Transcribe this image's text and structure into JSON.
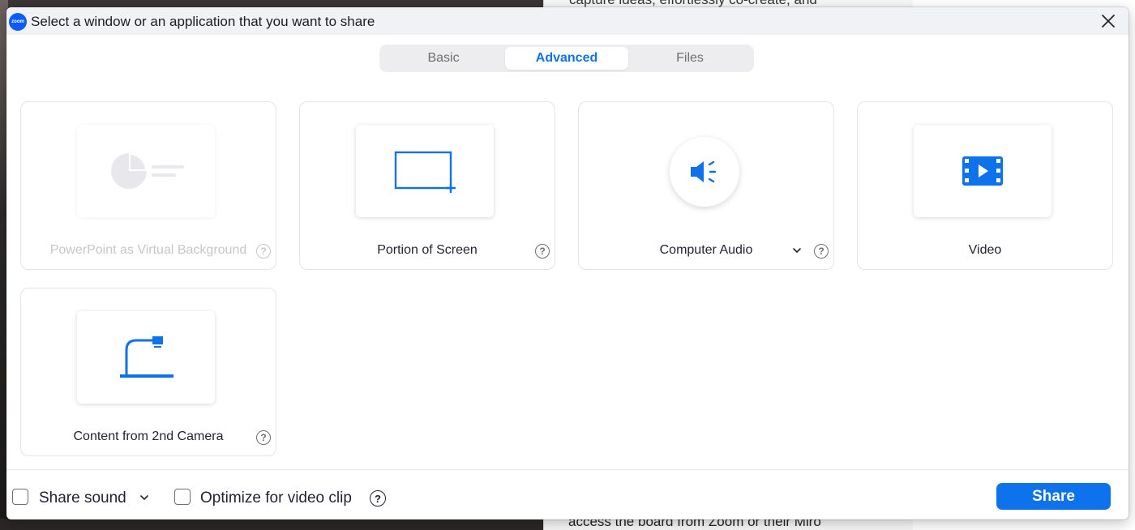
{
  "background": {
    "doc_text_top": "capture ideas, effortlessly co-create, and",
    "doc_text_bottom": "access the board from Zoom or their Miro"
  },
  "dialog": {
    "app_logo_text": "zoom",
    "title": "Select a window or an application that you want to share",
    "close_icon": "close-icon"
  },
  "tabs": [
    {
      "label": "Basic",
      "active": false
    },
    {
      "label": "Advanced",
      "active": true
    },
    {
      "label": "Files",
      "active": false
    }
  ],
  "options": [
    {
      "label": "PowerPoint as Virtual Background",
      "icon": "powerpoint-icon",
      "disabled": true,
      "help": "?"
    },
    {
      "label": "Portion of Screen",
      "icon": "screen-portion-icon",
      "disabled": false,
      "help": "?"
    },
    {
      "label": "Computer Audio",
      "icon": "speaker-icon",
      "disabled": false,
      "help": "?"
    },
    {
      "label": "Video",
      "icon": "video-icon",
      "disabled": false
    },
    {
      "label": "Content from 2nd Camera",
      "icon": "document-camera-icon",
      "disabled": false,
      "help": "?"
    }
  ],
  "footer": {
    "share_sound_label": "Share sound",
    "share_sound_checked": false,
    "optimize_label": "Optimize for video clip",
    "optimize_checked": false,
    "help_text": "?",
    "share_button": "Share"
  },
  "colors": {
    "accent": "#0e72ed",
    "disabled": "#c6c6cc"
  }
}
